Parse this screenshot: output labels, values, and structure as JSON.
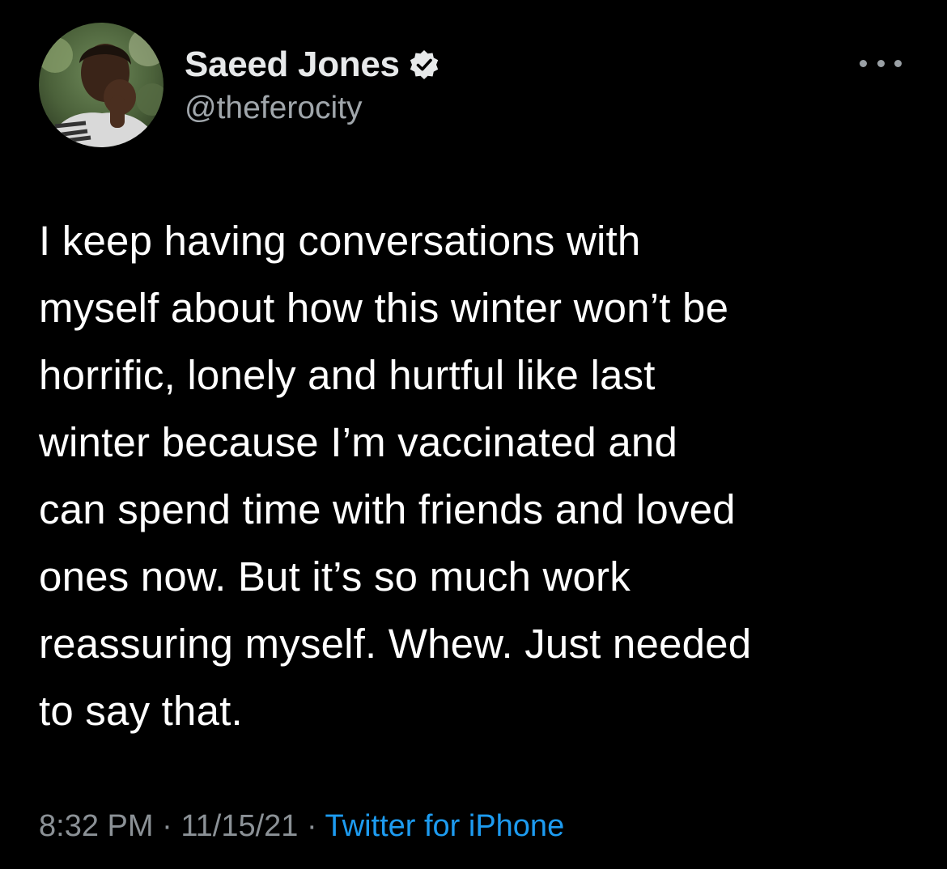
{
  "author": {
    "display_name": "Saeed Jones",
    "handle": "@theferocity",
    "verified": true,
    "avatar_icon": "profile-photo"
  },
  "menu": {
    "more_icon": "ellipsis-icon"
  },
  "tweet": {
    "text": "I keep having conversations with\nmyself about how this winter won’t be\nhorrific, lonely and hurtful like last\nwinter because I’m vaccinated and\ncan spend time with friends and loved\nones now. But it’s so much work\nreassuring myself. Whew. Just needed\nto say that."
  },
  "meta": {
    "time": "8:32 PM",
    "separator": " · ",
    "date": "11/15/21",
    "source": "Twitter for iPhone"
  },
  "colors": {
    "background": "#000000",
    "text": "#ffffff",
    "secondary": "#8b9196",
    "link": "#1d9bf0"
  }
}
